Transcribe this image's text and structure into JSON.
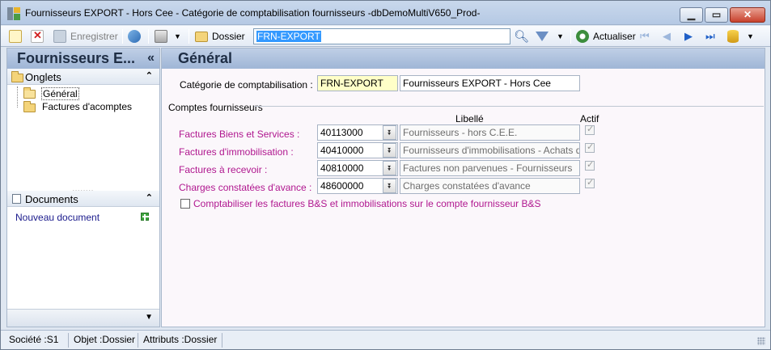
{
  "window": {
    "title": "Fournisseurs EXPORT - Hors Cee  -  Catégorie de comptabilisation fournisseurs -dbDemoMultiV650_Prod-"
  },
  "toolbar": {
    "save_label": "Enregistrer",
    "dossier_label": "Dossier",
    "search_value": "FRN-EXPORT",
    "refresh_label": "Actualiser"
  },
  "left": {
    "title": "Fournisseurs E...",
    "collapse_glyph": "«",
    "onglets_label": "Onglets",
    "tabs": [
      {
        "label": "Général"
      },
      {
        "label": "Factures d'acomptes"
      }
    ],
    "splitter": "........",
    "documents_label": "Documents",
    "new_document": "Nouveau document"
  },
  "main": {
    "title": "Général",
    "category_label": "Catégorie de comptabilisation :",
    "category_code": "FRN-EXPORT",
    "category_name": "Fournisseurs EXPORT - Hors Cee",
    "group_label": "Comptes fournisseurs",
    "col_libelle": "Libellé",
    "col_actif": "Actif",
    "rows": [
      {
        "label": "Factures Biens et Services :",
        "account": "40113000",
        "libelle": "Fournisseurs - hors C.E.E.",
        "actif": true
      },
      {
        "label": "Factures d'immobilisation :",
        "account": "40410000",
        "libelle": "Fournisseurs d'immobilisations - Achats d'immol",
        "actif": true
      },
      {
        "label": "Factures à recevoir :",
        "account": "40810000",
        "libelle": "Factures non parvenues - Fournisseurs",
        "actif": true
      },
      {
        "label": "Charges constatées d'avance :",
        "account": "48600000",
        "libelle": "Charges constatées d'avance",
        "actif": true
      }
    ],
    "checkbox_label": "Comptabiliser les factures B&S et immobilisations sur le compte fournisseur B&S",
    "checkbox_checked": false
  },
  "status": {
    "societe": "Société :S1",
    "objet": "Objet :Dossier",
    "attributs": "Attributs :Dossier"
  },
  "colors": {
    "accent_pink": "#b0178f",
    "header_blue": "#9fb6d6",
    "highlight": "#ffffc8"
  }
}
